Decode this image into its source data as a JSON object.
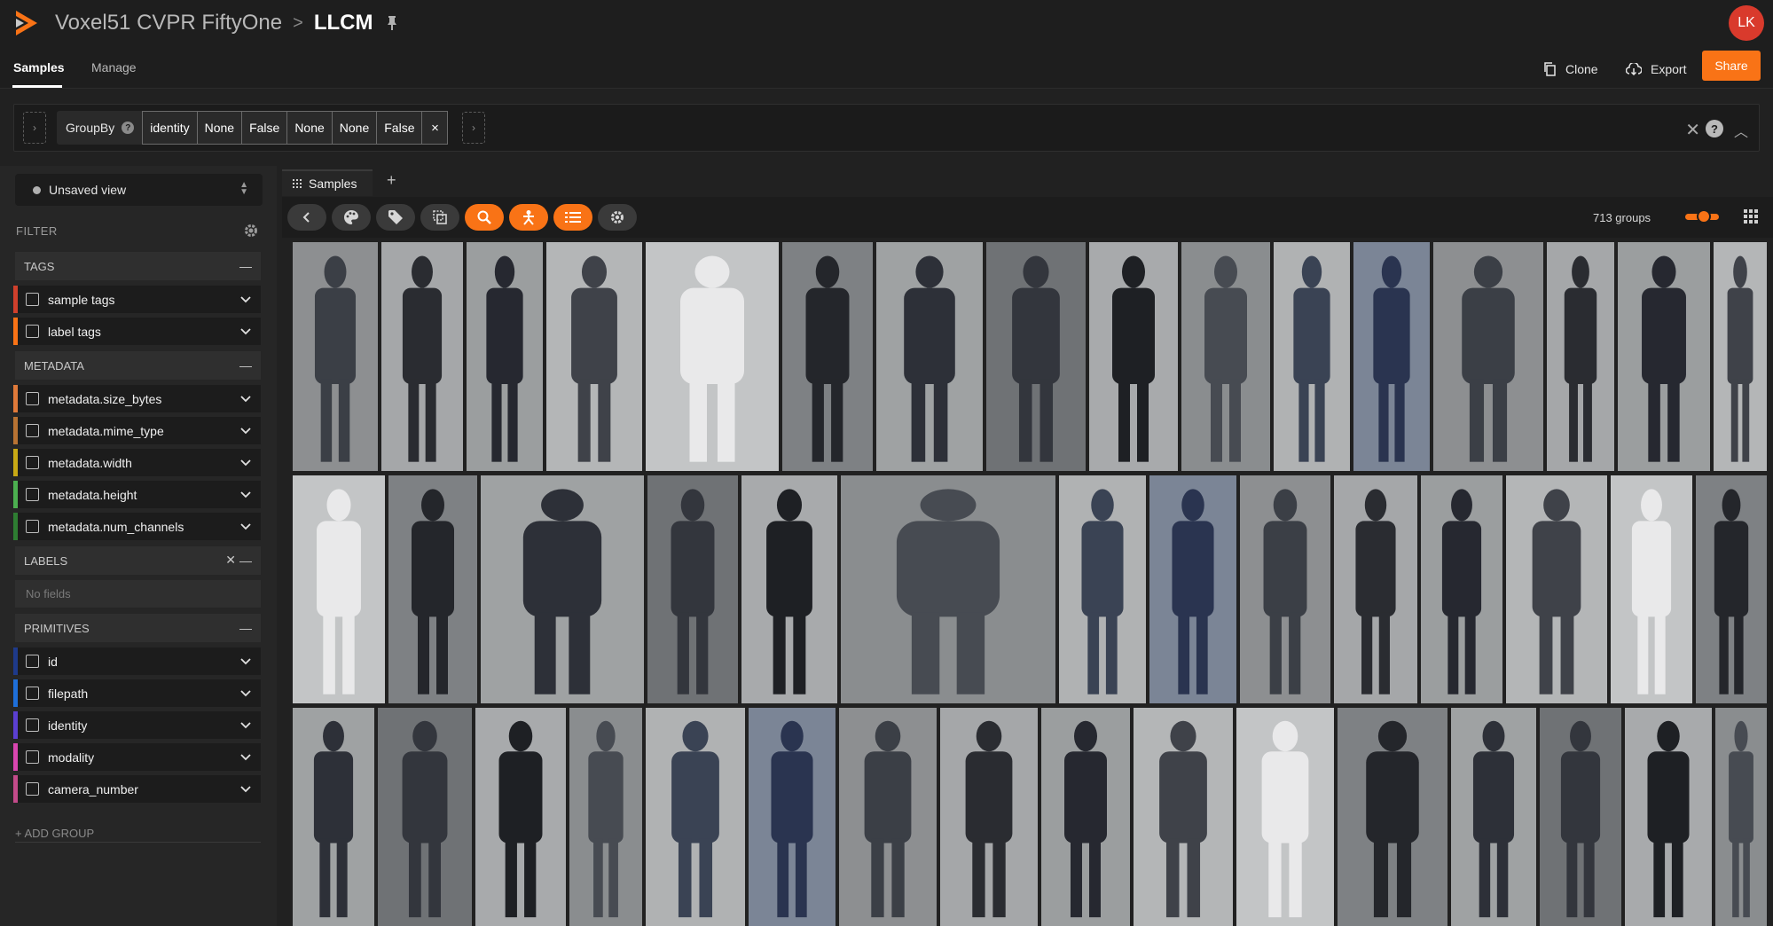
{
  "header": {
    "dataset_name": "Voxel51 CVPR FiftyOne",
    "separator": ">",
    "view_name": "LLCM",
    "avatar_initials": "LK",
    "brand_color": "#f97316"
  },
  "nav": {
    "tabs": [
      {
        "label": "Samples",
        "active": true
      },
      {
        "label": "Manage",
        "active": false
      }
    ],
    "clone_label": "Clone",
    "export_label": "Export",
    "share_label": "Share"
  },
  "view_bar": {
    "stage_name": "GroupBy",
    "params": [
      "identity",
      "None",
      "False",
      "None",
      "None",
      "False"
    ],
    "remove_symbol": "×"
  },
  "sidebar": {
    "saved_view": "Unsaved view",
    "filter_title": "FILTER",
    "groups": {
      "tags": {
        "title": "TAGS",
        "fields": [
          "sample tags",
          "label tags"
        ],
        "colors": [
          "#d0402c",
          "#f97316"
        ]
      },
      "metadata": {
        "title": "METADATA",
        "fields": [
          "metadata.size_bytes",
          "metadata.mime_type",
          "metadata.width",
          "metadata.height",
          "metadata.num_channels"
        ],
        "colors": [
          "#e07a3a",
          "#b87333",
          "#c8a915",
          "#4caf50",
          "#2e7d32"
        ]
      },
      "labels": {
        "title": "LABELS",
        "empty": "No fields"
      },
      "primitives": {
        "title": "PRIMITIVES",
        "fields": [
          "id",
          "filepath",
          "identity",
          "modality",
          "camera_number"
        ],
        "colors": [
          "#1e3a8a",
          "#1e6fd9",
          "#5b3fd1",
          "#d946b0",
          "#c34b8a"
        ]
      }
    },
    "add_group": "+ ADD GROUP"
  },
  "grid": {
    "tab_label": "Samples",
    "groups_count": "713 groups"
  }
}
